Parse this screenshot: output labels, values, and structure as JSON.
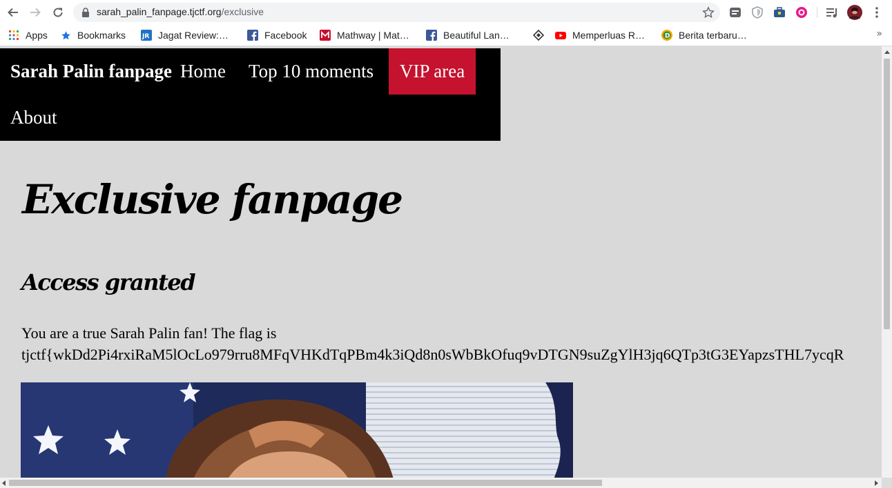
{
  "browser": {
    "url_host": "sarah_palin_fanpage.tjctf.org",
    "url_path": "/exclusive",
    "bookmarks": [
      {
        "label": "Apps",
        "icon": "apps-grid-icon"
      },
      {
        "label": "Bookmarks",
        "icon": "star-icon"
      },
      {
        "label": "Jagat Review:…",
        "icon": "jagat-review-icon"
      },
      {
        "label": "Facebook",
        "icon": "facebook-icon"
      },
      {
        "label": "Mathway | Mat…",
        "icon": "mathway-icon"
      },
      {
        "label": "Beautiful Lan…",
        "icon": "facebook-icon"
      },
      {
        "label": "",
        "icon": "diamond-icon"
      },
      {
        "label": "Memperluas R…",
        "icon": "youtube-icon"
      },
      {
        "label": "Berita terbaru…",
        "icon": "d-logo-icon"
      }
    ],
    "more_bookmarks": "»"
  },
  "page": {
    "nav": {
      "brand": "Sarah Palin fanpage",
      "items": [
        "Home",
        "Top 10 moments",
        "VIP area",
        "About"
      ],
      "active": "VIP area",
      "active_color": "#c4122f"
    },
    "title": "Exclusive fanpage",
    "subtitle": "Access granted",
    "message": "You are a true Sarah Palin fan! The flag is",
    "flag": "tjctf{wkDd2Pi4rxiRaM5lOcLo979rru8MFqVHKdTqPBm4k3iQd8n0sWbBkOfuq9vDTGN9suZgYlH3jq6QTp3tG3EYapzsTHL7ycqR"
  },
  "colors": {
    "page_background": "#d9d9d9",
    "nav_background": "#000000"
  }
}
